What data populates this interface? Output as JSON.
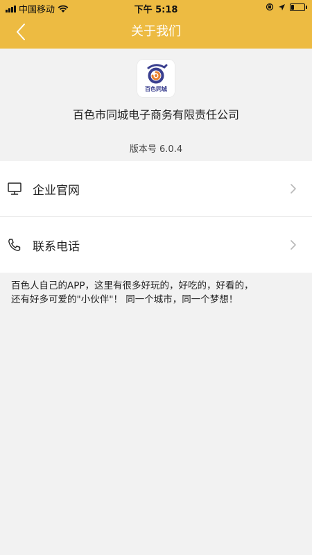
{
  "status_bar": {
    "carrier": "中国移动",
    "time": "下午 5:18",
    "battery_level": 0.25,
    "icons": [
      "signal-icon",
      "wifi-icon",
      "orientation-lock-icon",
      "location-arrow-icon",
      "battery-icon"
    ]
  },
  "nav": {
    "title": "关于我们",
    "back_icon": "chevron-left-icon"
  },
  "app": {
    "logo_text": "百色同城",
    "company_name": "百色市同城电子商务有限责任公司",
    "version": "版本号 6.0.4"
  },
  "menu": {
    "items": [
      {
        "label": "企业官网",
        "icon": "monitor-icon"
      },
      {
        "label": "联系电话",
        "icon": "phone-icon"
      }
    ]
  },
  "description": {
    "line1": "百色人自己的APP，这里有很多好玩的，好吃的，好看的，",
    "line2": "还有好多可爱的\"小伙伴\"！ 同一个城市，同一个梦想！"
  },
  "colors": {
    "header": "#edbb42",
    "background": "#f2f2f2",
    "logo_blue": "#3a3f8f",
    "logo_orange": "#e9812f"
  }
}
